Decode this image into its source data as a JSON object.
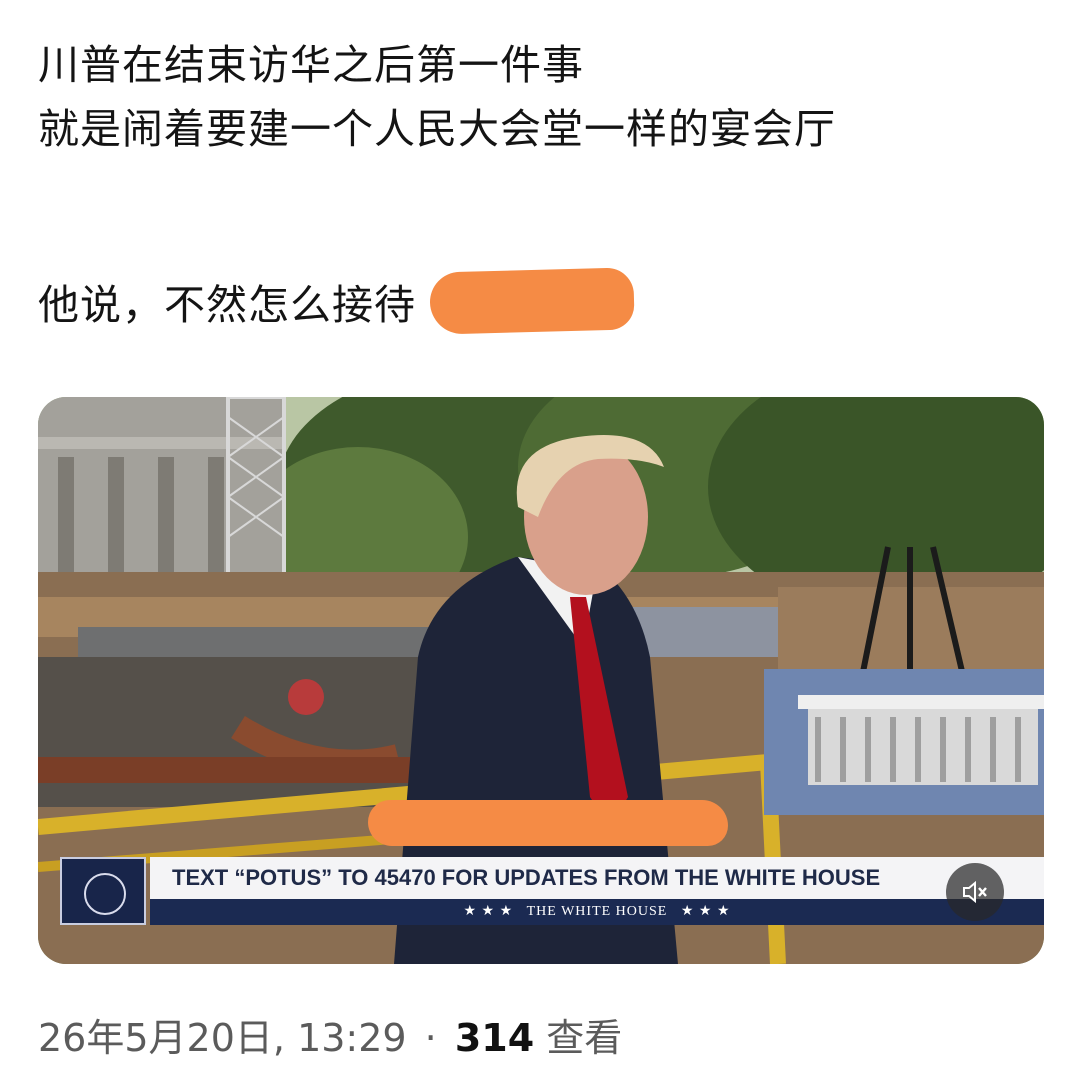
{
  "post": {
    "line1": "川普在结束访华之后第一件事",
    "line2": "就是闹着要建一个人民大会堂一样的宴会厅",
    "line3": "他说，不然怎么接待"
  },
  "video": {
    "ticker_text": "TEXT “POTUS” TO 45470 FOR UPDATES FROM THE WHITE HOUSE",
    "ticker_stars_left": "★ ★ ★",
    "ticker_brand": "THE WHITE HOUSE",
    "ticker_stars_right": "★ ★ ★",
    "mute_icon": "speaker-muted-icon"
  },
  "meta": {
    "date": "26年5月20日,",
    "time": "13:29",
    "separator": "·",
    "views_count": "314",
    "views_label": "查看"
  },
  "colors": {
    "censor": "#f58b45",
    "ticker_navy": "#1b2a52",
    "text": "#141414",
    "meta_gray": "#5b5b5b"
  }
}
